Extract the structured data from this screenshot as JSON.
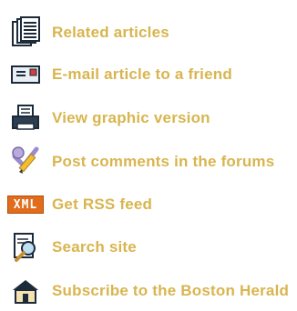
{
  "links": [
    {
      "id": "related",
      "label": "Related articles",
      "icon": "documents-icon"
    },
    {
      "id": "email",
      "label": "E-mail article to a friend",
      "icon": "envelope-icon"
    },
    {
      "id": "graphic",
      "label": "View graphic version",
      "icon": "printer-icon"
    },
    {
      "id": "comments",
      "label": "Post comments in the forums",
      "icon": "comment-pencil-icon"
    },
    {
      "id": "rss",
      "label": "Get RSS feed",
      "icon": "xml-badge-icon",
      "badge_text": "XML"
    },
    {
      "id": "search",
      "label": "Search site",
      "icon": "search-page-icon"
    },
    {
      "id": "subscribe",
      "label": "Subscribe to the Boston Herald",
      "icon": "house-icon"
    }
  ],
  "colors": {
    "label": "#d8b54f",
    "icon_dark": "#1c2a3a",
    "rss_badge": "#e06c1c"
  }
}
